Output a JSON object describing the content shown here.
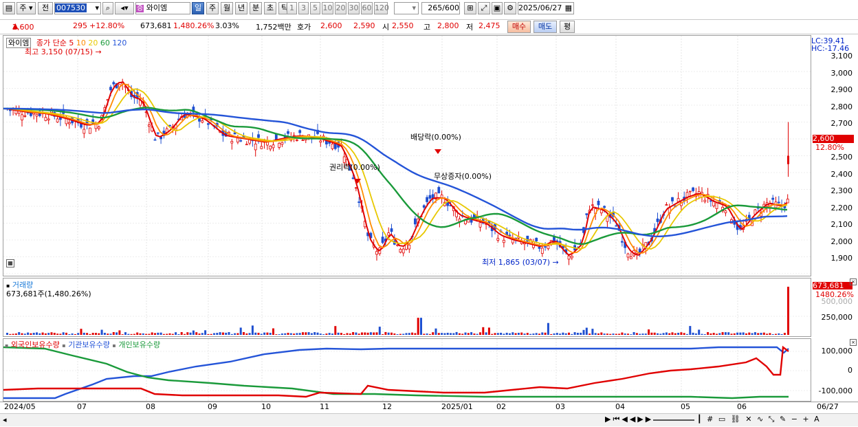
{
  "toolbar": {
    "period_label": "주",
    "prev_label": "전",
    "code": "007530",
    "name": "와이엠",
    "timeframes": [
      "일",
      "주",
      "월",
      "년",
      "분",
      "초",
      "틱"
    ],
    "numbers": [
      "1",
      "3",
      "5",
      "10",
      "20",
      "30",
      "60",
      "120"
    ],
    "count": "265",
    "count_total": "/600",
    "date": "2025/06/27"
  },
  "quote": {
    "price": "2,600",
    "change": "295",
    "change_pct": "+12.80%",
    "volume": "673,681",
    "volume_pct": "1,480.26%",
    "turnover": "3.03%",
    "amount": "1,752백만",
    "hoga_label": "호가",
    "hoga_ask": "2,600",
    "hoga_bid": "2,590",
    "open_label": "시",
    "open": "2,550",
    "high_label": "고",
    "high": "2,800",
    "low_label": "저",
    "low": "2,475",
    "buy_label": "매수",
    "sell_label": "매도",
    "flat_label": "평"
  },
  "price_panel": {
    "title": "와이엠",
    "legend_prefix": "종가 단순",
    "ma_labels": [
      "5",
      "10",
      "20",
      "60",
      "120"
    ],
    "ma_colors": [
      "#e00000",
      "#ff8c00",
      "#e8c800",
      "#1a9a3a",
      "#2454d8"
    ],
    "high_annotation": "최고 3,150 (07/15)",
    "low_annotation": "최저 1,865 (03/07)",
    "events": [
      "배당락(0.00%)",
      "권리락(0.00%)",
      "무상증자(0.00%)"
    ],
    "lc": "LC:39.41",
    "hc": "HC:-17.46",
    "last_price": "2,600",
    "last_pct": "12.80%",
    "y_ticks": [
      "3,100",
      "3,000",
      "2,900",
      "2,800",
      "2,700",
      "2,600",
      "2,500",
      "2,400",
      "2,300",
      "2,200",
      "2,100",
      "2,000",
      "1,900"
    ]
  },
  "volume_panel": {
    "title": "거래량",
    "value": "673,681주(1,480.26%)",
    "last_value": "673,681",
    "last_pct": "1480.26%",
    "y_ticks": [
      "500,000",
      "250,000"
    ]
  },
  "holding_panel": {
    "series": [
      "외국인보유수량",
      "기관보유수량",
      "개인보유수량"
    ],
    "colors": [
      "#e00000",
      "#2454d8",
      "#1a9a3a"
    ],
    "y_ticks": [
      "100,000",
      "0",
      "-100,000"
    ]
  },
  "date_axis": [
    "2024/05",
    "07",
    "08",
    "09",
    "10",
    "11",
    "12",
    "2025/01",
    "02",
    "03",
    "04",
    "05",
    "06",
    "06/27"
  ]
}
